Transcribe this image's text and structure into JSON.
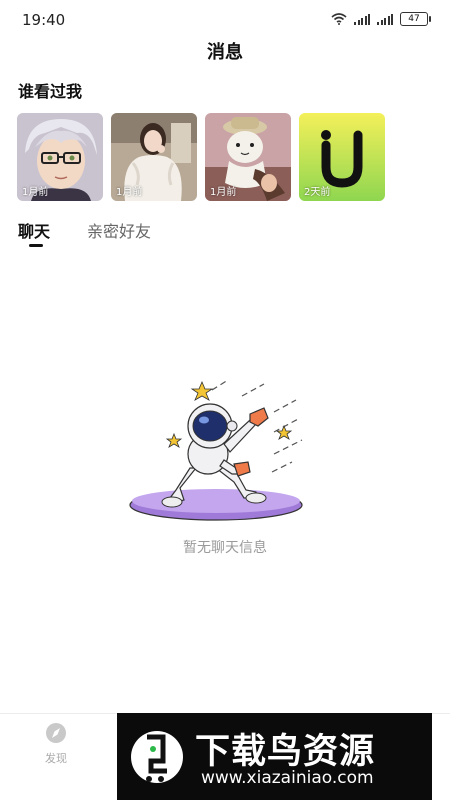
{
  "status_bar": {
    "time": "19:40",
    "battery": "47"
  },
  "header": {
    "title": "消息"
  },
  "visitors": {
    "title": "谁看过我",
    "items": [
      {
        "time": "1月前",
        "icon": "anime-man-glasses-avatar"
      },
      {
        "time": "1月前",
        "icon": "woman-white-coat-avatar"
      },
      {
        "time": "1月前",
        "icon": "cartoon-cat-hat-avatar"
      },
      {
        "time": "2天前",
        "icon": "yellow-u-logo-avatar"
      }
    ]
  },
  "tabs": [
    {
      "label": "聊天",
      "active": true
    },
    {
      "label": "亲密好友",
      "active": false
    }
  ],
  "empty_state": {
    "text": "暂无聊天信息",
    "icon": "astronaut-skateboard-illustration"
  },
  "bottom_nav": {
    "items": [
      {
        "label": "发现",
        "icon": "compass-icon"
      }
    ]
  },
  "watermark": {
    "title": "下载鸟资源",
    "url": "www.xiazainiao.com"
  },
  "colors": {
    "accent_purple": "#8f63d8",
    "astronaut_orange": "#ef7a4a",
    "star_yellow": "#f3c534"
  }
}
